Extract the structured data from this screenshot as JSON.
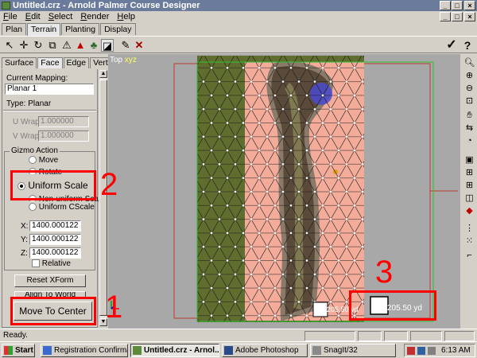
{
  "window": {
    "title": "Untitled.crz - Arnold Palmer Course Designer",
    "controls": [
      "_",
      "□",
      "×"
    ]
  },
  "menu": [
    "File",
    "Edit",
    "Select",
    "Render",
    "Help"
  ],
  "top_tabs": [
    "Plan",
    "Terrain",
    "Planting",
    "Display"
  ],
  "active_top_tab": "Terrain",
  "toolbar": {
    "icons": [
      "select-arrow-icon",
      "move-cross-icon",
      "rotate-icon",
      "scale-icon",
      "warning-triangle-icon",
      "red-triangle-icon",
      "tree-icon",
      "terrain-tool-icon",
      "brush-icon",
      "delete-x-icon"
    ],
    "confirm_glyph": "✓",
    "help_glyph": "?"
  },
  "sub_tabs": [
    "Surface",
    "Face",
    "Edge",
    "Vertex"
  ],
  "active_sub_tab": "Face",
  "panel": {
    "current_mapping_label": "Current Mapping:",
    "current_mapping_value": "Planar 1",
    "type_text": "Type: Planar",
    "u_wrap_label": "U Wrap:",
    "u_wrap_value": "1.000000",
    "v_wrap_label": "V Wrap:",
    "v_wrap_value": "1.000000",
    "gizmo_title": "Gizmo Action",
    "radios": [
      {
        "label": "Move",
        "selected": false
      },
      {
        "label": "Rotate",
        "selected": false
      },
      {
        "label": "Uniform Scale",
        "selected": true
      },
      {
        "label": "Non-uniform Scale",
        "selected": false
      },
      {
        "label": "Uniform CScale",
        "selected": false
      }
    ],
    "x_label": "X:",
    "x_value": "1400.000122",
    "y_label": "Y:",
    "y_value": "1400.000122",
    "z_label": "Z:",
    "z_value": "1400.000122",
    "relative_label": "Relative",
    "reset_button": "Reset XForm",
    "align_button": "Align To World",
    "move_to_center_button": "Move To Center"
  },
  "viewport": {
    "label_top": "Top",
    "label_xyz": "xyz",
    "gizmo_size_1": "205.50 yd",
    "gizmo_size_2": "205.50 yd",
    "colors": {
      "rough": "#5f6d2f",
      "fairway_mesh": "#f3ab9a",
      "frame": "#c0392b",
      "bg": "#a8a8a8"
    }
  },
  "annotations": {
    "num1": "1",
    "num2": "2",
    "num3": "3",
    "color": "#ff0000"
  },
  "status": {
    "text": "Ready."
  },
  "taskbar": {
    "start": "Start",
    "items": [
      {
        "label": "Registration Confirmatio...",
        "active": false
      },
      {
        "label": "Untitled.crz - Arnol...",
        "active": true
      },
      {
        "label": "Adobe Photoshop",
        "active": false
      },
      {
        "label": "SnagIt/32",
        "active": false
      }
    ],
    "time": "6:13 AM"
  }
}
